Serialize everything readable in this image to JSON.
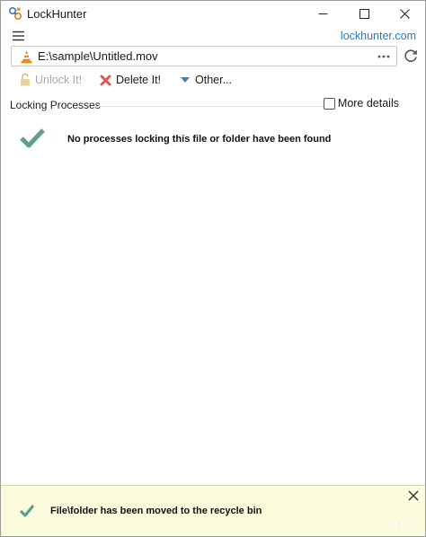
{
  "window": {
    "title": "LockHunter"
  },
  "menubar": {
    "site_link": "lockhunter.com"
  },
  "path": {
    "value": "E:\\sample\\Untitled.mov",
    "browse_label": "•••"
  },
  "toolbar": {
    "unlock_label": "Unlock It!",
    "delete_label": "Delete It!",
    "other_label": "Other..."
  },
  "section": {
    "title": "Locking Processes",
    "more_details_label": "More details",
    "more_details_checked": false
  },
  "empty_state": {
    "message": "No processes locking this file or folder have been found"
  },
  "notification": {
    "message": "File\\folder has been moved to the recycle bin"
  },
  "watermark": {
    "text": "XDA"
  },
  "colors": {
    "accent_link": "#2a7abf",
    "check_green": "#5f9e8a",
    "delete_red": "#d65a5a",
    "notification_bg": "#fdfbdd"
  },
  "icons": {
    "app": "lock-hunter-icon",
    "file": "vlc-cone-icon",
    "refresh": "refresh-icon",
    "unlock": "unlock-icon",
    "delete": "red-x-icon",
    "other": "triangle-down-icon",
    "success": "check-icon",
    "close": "close-icon"
  }
}
